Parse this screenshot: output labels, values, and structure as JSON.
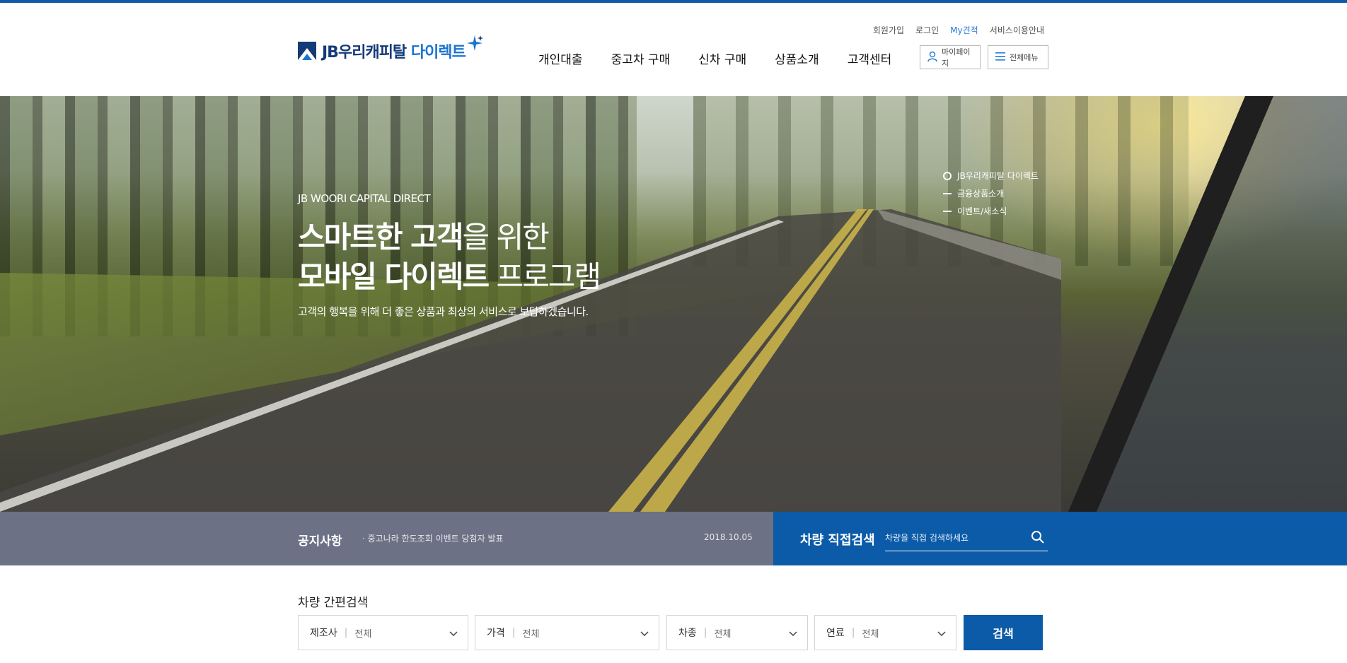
{
  "colors": {
    "accent": "#0b5ba8",
    "notice_bg": "#6c7185",
    "brand_navy": "#153a78",
    "brand_blue": "#1b74d0"
  },
  "util_nav": {
    "signup": "회원가입",
    "login": "로그인",
    "my_quote": "My견적",
    "service_guide": "서비스이용안내"
  },
  "logo": {
    "prefix": "JB",
    "name": "우리캐피탈",
    "direct": "다이렉트"
  },
  "gnb": {
    "personal_loan": "개인대출",
    "used_car": "중고차 구매",
    "new_car": "신차 구매",
    "products": "상품소개",
    "customer_center": "고객센터"
  },
  "header_buttons": {
    "mypage": "마이페이지",
    "all_menu": "전체메뉴"
  },
  "hero": {
    "eyebrow": "JB WOORI CAPITAL DIRECT",
    "title_line1_bold": "스마트한 고객",
    "title_line1_light": "을 위한",
    "title_line2_bold": "모바일 다이렉트",
    "title_line2_light": " 프로그램",
    "description": "고객의 행복을 위해 더 좋은 상품과 최상의 서비스로 보답하겠습니다.",
    "nav": [
      "JB우리캐피탈 다이렉트",
      "금융상품소개",
      "이벤트/새소식"
    ]
  },
  "notice": {
    "title": "공지사항",
    "item": "· 중고나라 한도조회 이벤트 당첨자 발표",
    "date": "2018.10.05"
  },
  "vehicle_search": {
    "title": "차량 직접검색",
    "placeholder": "차량을 직접 검색하세요"
  },
  "quick_search": {
    "title": "차량 간편검색",
    "maker": {
      "label": "제조사",
      "value": "전체"
    },
    "price": {
      "label": "가격",
      "value": "전체"
    },
    "type": {
      "label": "차종",
      "value": "전체"
    },
    "fuel": {
      "label": "연료",
      "value": "전체"
    },
    "submit": "검색"
  }
}
